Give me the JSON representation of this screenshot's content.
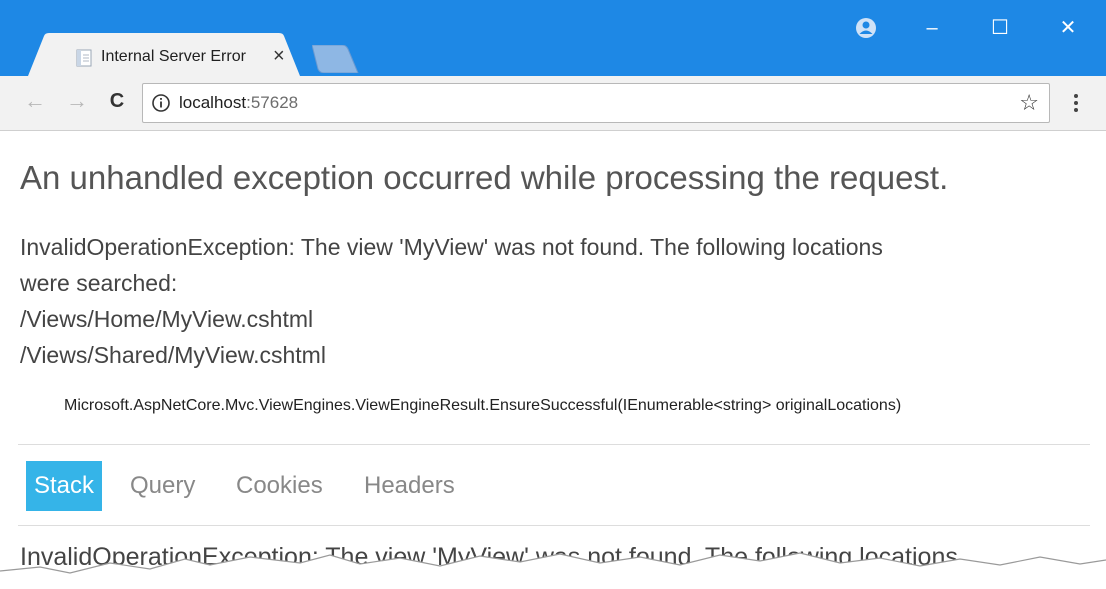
{
  "window": {
    "tab_title": "Internal Server Error",
    "tab_close": "×",
    "controls": {
      "minimize": "–",
      "maximize": "☐",
      "close": "✕"
    }
  },
  "toolbar": {
    "back": "←",
    "forward": "→",
    "reload": "C",
    "url_host": "localhost",
    "url_port": ":57628",
    "star": "☆"
  },
  "page": {
    "heading": "An unhandled exception occurred while processing the request.",
    "exception_lines": [
      "InvalidOperationException: The view 'MyView' was not found. The following locations",
      "were searched:",
      "/Views/Home/MyView.cshtml",
      "/Views/Shared/MyView.cshtml"
    ],
    "location": "Microsoft.AspNetCore.Mvc.ViewEngines.ViewEngineResult.EnsureSuccessful(IEnumerable<string> originalLocations)",
    "tabs": [
      {
        "label": "Stack",
        "active": true
      },
      {
        "label": "Query",
        "active": false
      },
      {
        "label": "Cookies",
        "active": false
      },
      {
        "label": "Headers",
        "active": false
      }
    ],
    "cut_off_text": "InvalidOperationException: The view 'MyView' was not found. The following locations"
  },
  "colors": {
    "titlebar": "#1e88e5",
    "active_tab": "#35b4e8"
  }
}
